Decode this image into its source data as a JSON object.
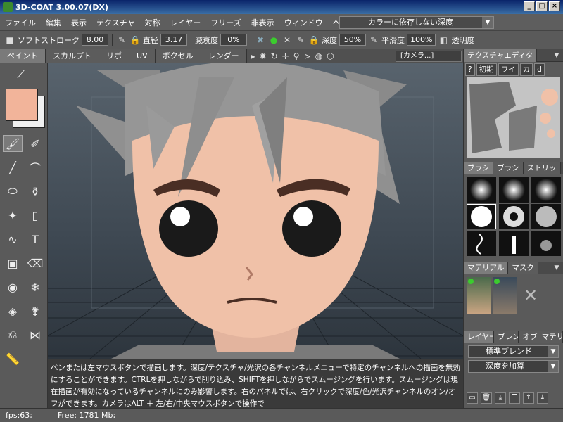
{
  "window": {
    "title": "3D-COAT 3.00.07(DX)"
  },
  "menu": [
    "ファイル",
    "編集",
    "表示",
    "テクスチャ",
    "対称",
    "レイヤー",
    "フリーズ",
    "非表示",
    "ウィンドウ",
    "ヘルプ"
  ],
  "depth_mode": "カラーに依存しない深度",
  "toolbar": {
    "soft_stroke_label": "ソフトストローク",
    "soft_stroke_value": "8.00",
    "diameter_label": "直径",
    "diameter_value": "3.17",
    "falloff_label": "減衰度",
    "falloff_value": "0%",
    "depth_label": "深度",
    "depth_value": "50%",
    "smooth_label": "平滑度",
    "smooth_value": "100%",
    "opacity_label": "透明度"
  },
  "tabs": [
    "ペイント",
    "スカルプト",
    "リポ",
    "UV",
    "ボクセル",
    "レンダー"
  ],
  "camera_label": "[カメラ...]",
  "help_text": "ペンまたは左マウスボタンで描画します。深度/テクスチャ/光沢の各チャンネルメニューで特定のチャンネルへの描画を無効にすることができます。CTRLを押しながらで削り込み、SHIFTを押しながらでスムージングを行います。スムージングは現在描画が有効になっているチャンネルにのみ影響します。右のパネルでは、右クリックで深度/色/光沢チャンネルのオン/オフができます。カメラはALT ＋ 左/右/中央マウスボタンで操作で",
  "status": {
    "fps": "fps:63;",
    "free": "Free: 1781 Mb;"
  },
  "right_panel": {
    "texture_editor_tab": "テクスチャエディタ",
    "texture_buttons": [
      "?",
      "初期",
      "ワイ",
      "カ",
      "d"
    ],
    "brush_tabs": [
      "ブラシ",
      "ブラシ",
      "ストリッ"
    ],
    "material_tabs": [
      "マテリアル",
      "マスク"
    ],
    "layer_tabs": [
      "レイヤー",
      "ブレン",
      "オブ",
      "マテリ"
    ],
    "blend_mode": "標準ブレンド",
    "depth_add": "深度を加算"
  },
  "colors": {
    "primary": "#f2b49a",
    "secondary": "#f0f0f0",
    "accent_green": "#3bcc2e"
  }
}
